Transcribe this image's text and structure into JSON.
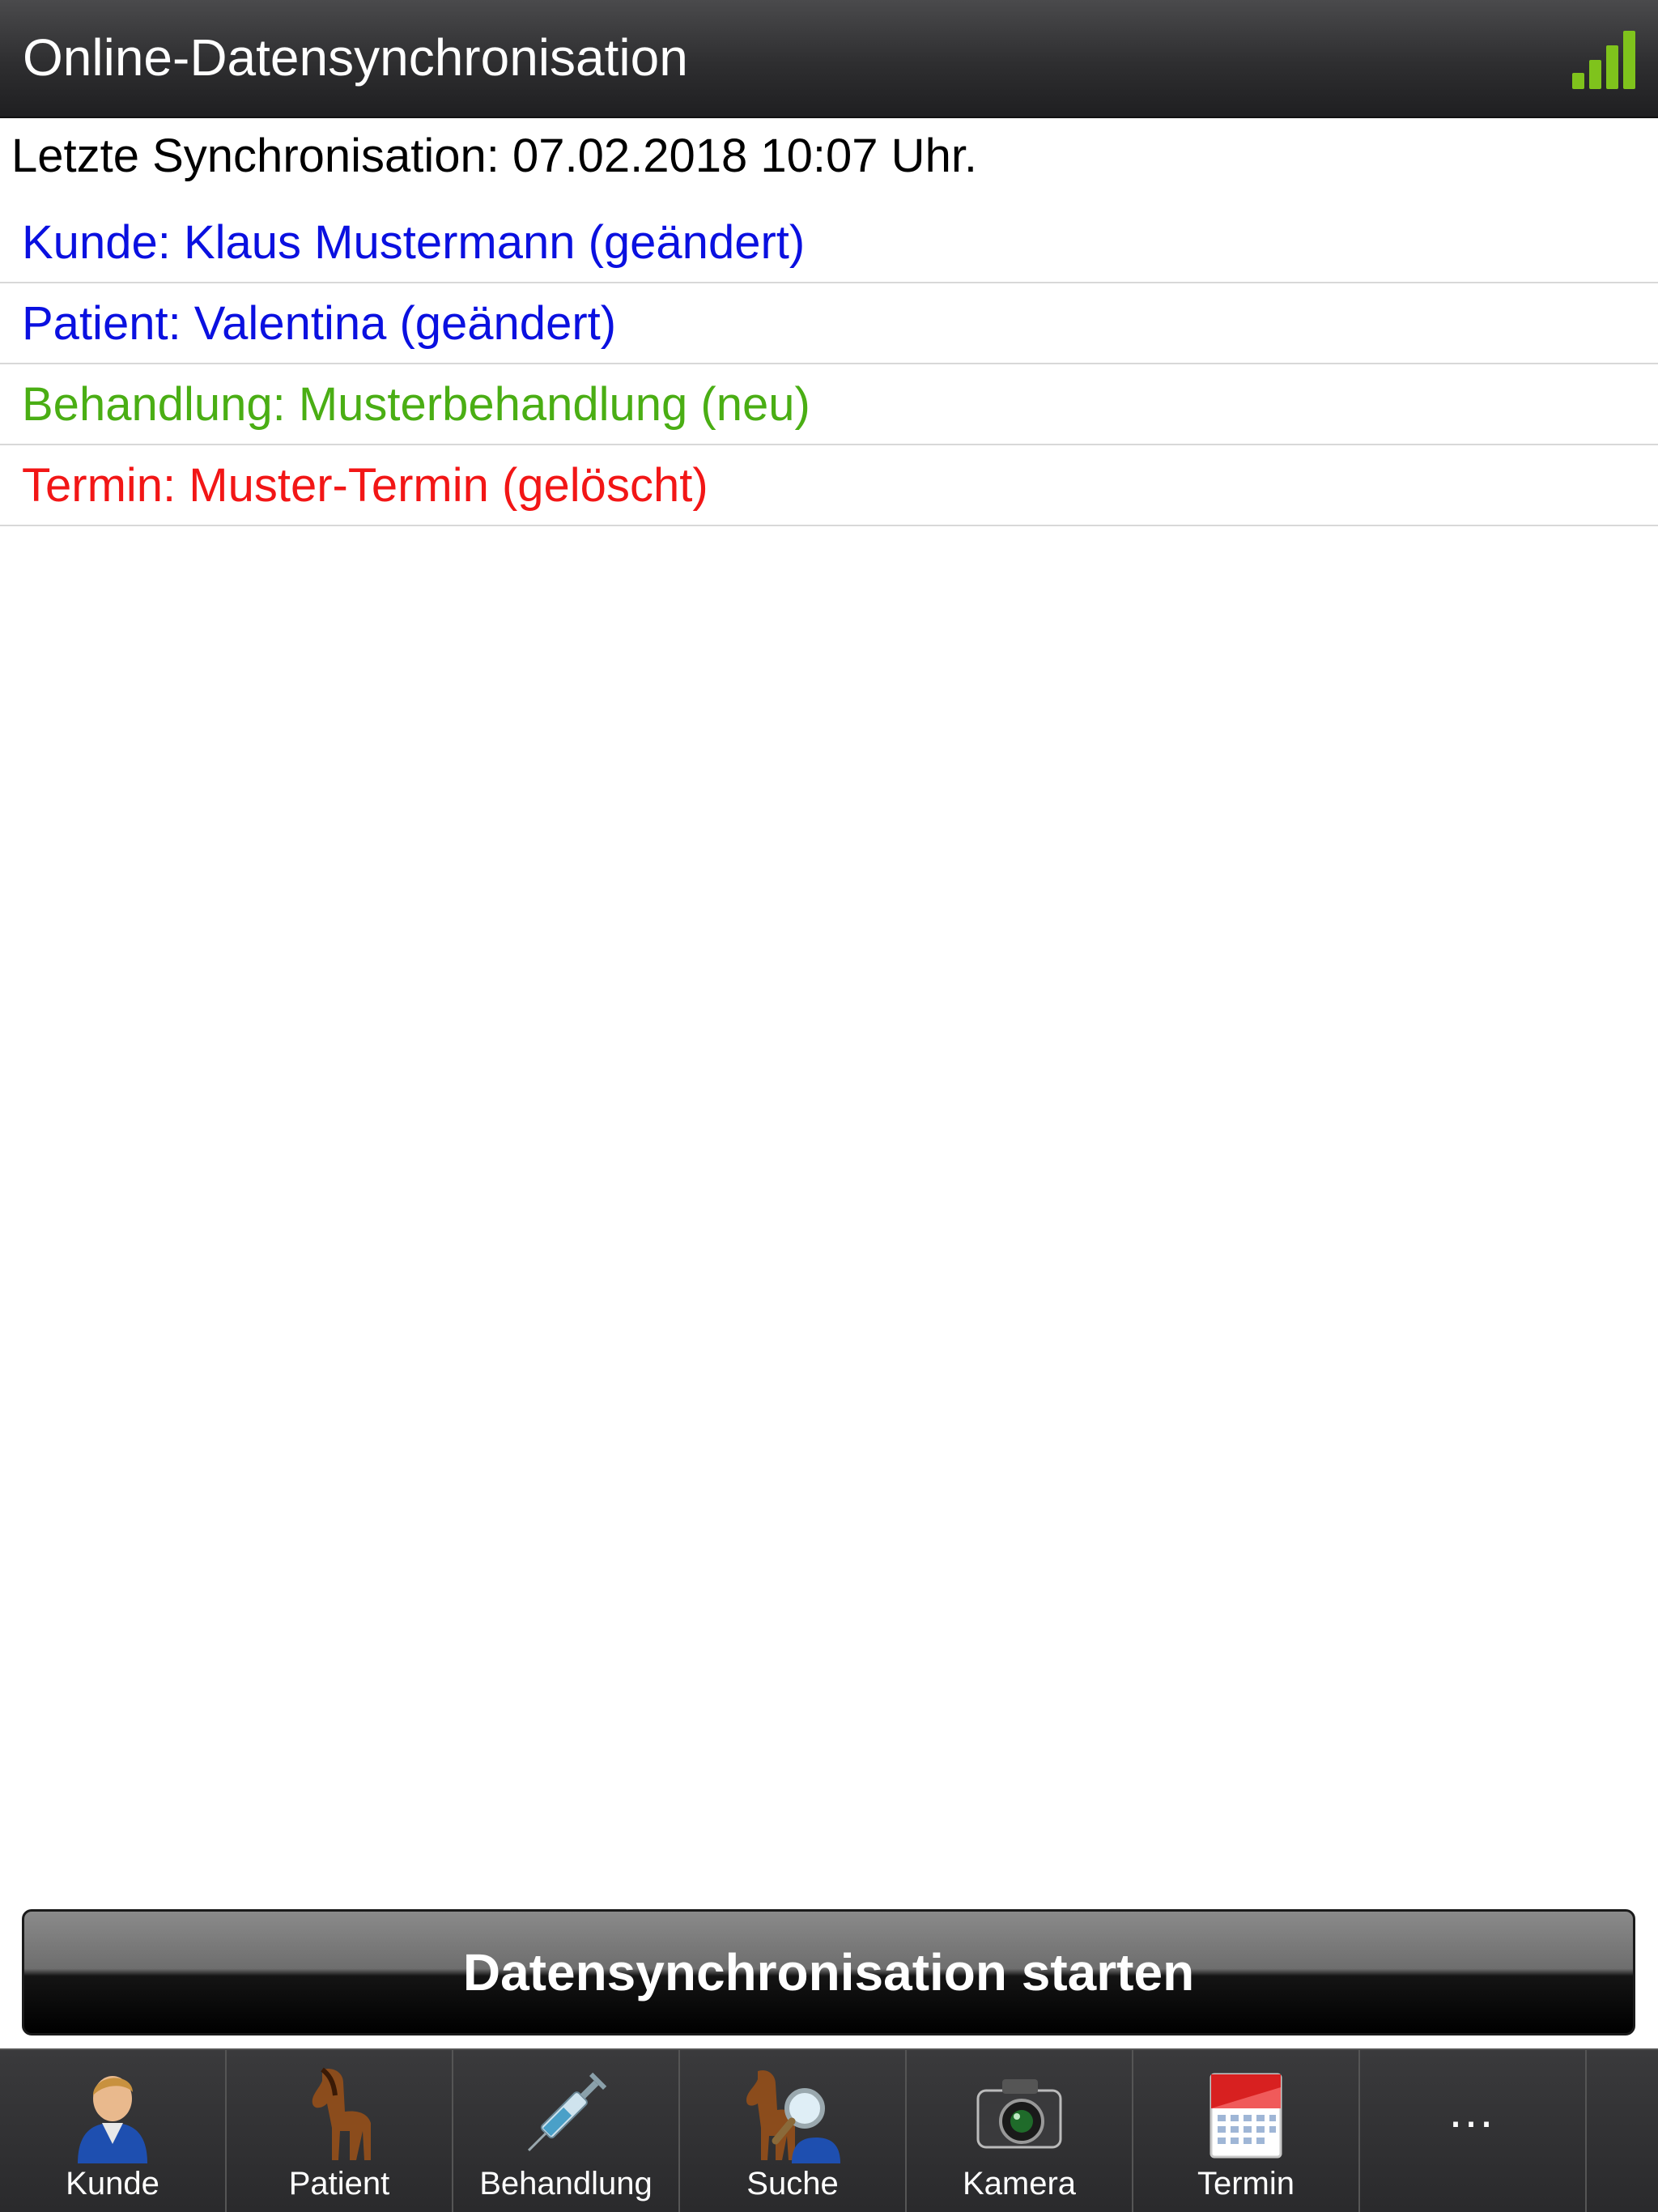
{
  "header": {
    "title": "Online-Datensynchronisation",
    "signal_icon": "signal-bars-icon"
  },
  "last_sync": "Letzte Synchronisation: 07.02.2018 10:07 Uhr.",
  "changes": [
    {
      "text": "Kunde: Klaus Mustermann (geändert)",
      "color": "#0a10e0"
    },
    {
      "text": "Patient: Valentina (geändert)",
      "color": "#0a10e0"
    },
    {
      "text": "Behandlung: Musterbehandlung (neu)",
      "color": "#4aae14"
    },
    {
      "text": "Termin: Muster-Termin (gelöscht)",
      "color": "#f21616"
    }
  ],
  "start_button": "Datensynchronisation starten",
  "tabs": [
    {
      "label": "Kunde",
      "icon": "person-icon"
    },
    {
      "label": "Patient",
      "icon": "horse-icon"
    },
    {
      "label": "Behandlung",
      "icon": "syringe-icon"
    },
    {
      "label": "Suche",
      "icon": "search-icon"
    },
    {
      "label": "Kamera",
      "icon": "camera-icon"
    },
    {
      "label": "Termin",
      "icon": "calendar-icon"
    },
    {
      "label": "…",
      "icon": "more-icon"
    }
  ]
}
